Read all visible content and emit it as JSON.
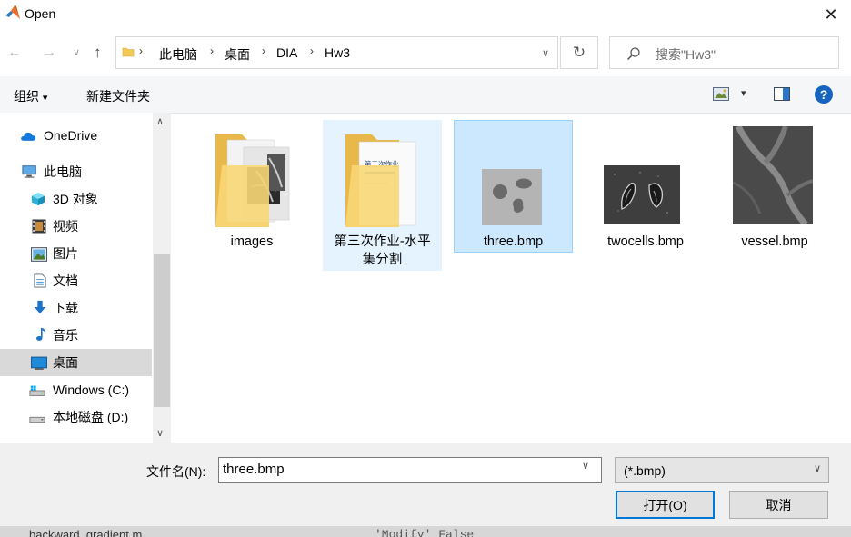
{
  "window": {
    "title": "Open",
    "close_symbol": "✕"
  },
  "nav": {
    "back_symbol": "←",
    "forward_symbol": "→",
    "recent_symbol": "∨",
    "up_symbol": "↑",
    "breadcrumb": [
      "此电脑",
      "桌面",
      "DIA",
      "Hw3"
    ],
    "separator": "›",
    "dropdown_symbol": "∨",
    "refresh_symbol": "↻",
    "search_placeholder": "搜索\"Hw3\""
  },
  "toolbar": {
    "organize_label": "组织",
    "organize_arrow": "▾",
    "new_folder_label": "新建文件夹",
    "view_arrow": "▾",
    "help_symbol": "?"
  },
  "sidebar": {
    "items": [
      {
        "label": "OneDrive",
        "icon": "cloud-icon"
      },
      {
        "label": "此电脑",
        "icon": "computer-icon"
      },
      {
        "label": "3D 对象",
        "icon": "cube-3d-icon"
      },
      {
        "label": "视频",
        "icon": "film-icon"
      },
      {
        "label": "图片",
        "icon": "picture-icon"
      },
      {
        "label": "文档",
        "icon": "document-icon"
      },
      {
        "label": "下载",
        "icon": "download-arrow-icon"
      },
      {
        "label": "音乐",
        "icon": "music-note-icon"
      },
      {
        "label": "桌面",
        "icon": "desktop-icon",
        "selected": true
      },
      {
        "label": "Windows (C:)",
        "icon": "windows-drive-icon"
      },
      {
        "label": "本地磁盘 (D:)",
        "icon": "disk-drive-icon"
      }
    ],
    "scroll_up": "∧",
    "scroll_down": "∨"
  },
  "files": [
    {
      "name": "images",
      "type": "folder"
    },
    {
      "name": "第三次作业-水平集分割",
      "type": "folder",
      "state": "hover",
      "line1": "第三次作业-水平",
      "line2": "集分割",
      "doc_heading": "第三次作业"
    },
    {
      "name": "three.bmp",
      "type": "image",
      "state": "selected"
    },
    {
      "name": "twocells.bmp",
      "type": "image"
    },
    {
      "name": "vessel.bmp",
      "type": "image"
    }
  ],
  "bottom": {
    "filename_label": "文件名(N):",
    "filename_value": "three.bmp",
    "filename_dropdown": "∨",
    "filter_value": "(*.bmp)",
    "filter_dropdown": "∨",
    "open_label": "打开(O)",
    "cancel_label": "取消"
  },
  "background_strip": {
    "left_text": "backward_gradient.m",
    "right_text": "'Modify' False"
  },
  "colors": {
    "selection": "#cce8ff",
    "selection_border": "#99d1ff",
    "hover": "#e5f3ff",
    "sidebar_selected": "#d9d9d9",
    "accent": "#0078d7",
    "folder": "#f8d775"
  }
}
